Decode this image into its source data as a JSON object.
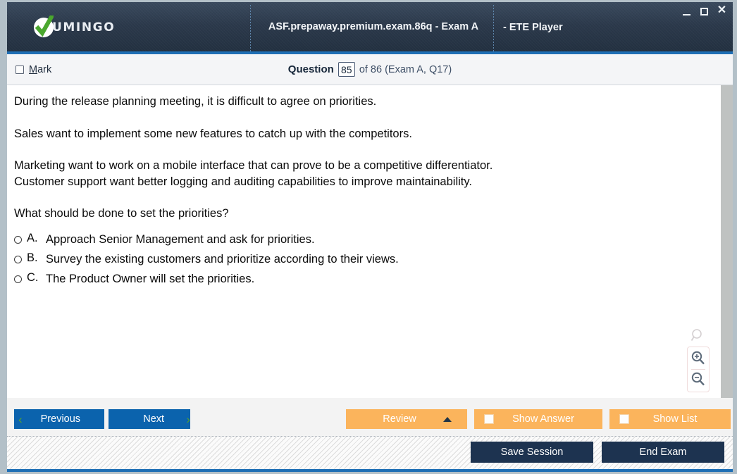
{
  "window": {
    "brand_name": "UMINGO",
    "brand_icon": "green-check-circle-icon",
    "title": "ASF.prepaway.premium.exam.86q - Exam A",
    "title_tail": "- ETE Player",
    "controls": {
      "minimize": "minimize-icon",
      "maximize": "maximize-icon",
      "close": "✕"
    },
    "accent_color": "#1f6fb5"
  },
  "status_bar": {
    "mark_label_prefix": "",
    "mark_label": "Mark",
    "mark_checked": false,
    "question_word": "Question",
    "question_number": "85",
    "question_total": "of 86 (Exam A, Q17)"
  },
  "question": {
    "paragraphs": [
      "During the release planning meeting, it is difficult to agree on priorities.",
      "Sales want to implement some new features to catch up with the competitors.",
      "Marketing want to work on a mobile interface that can prove to be a competitive differentiator.",
      "Customer support want better logging and auditing capabilities to improve maintainability.",
      "What should be done to set the priorities?"
    ],
    "answers": [
      {
        "letter": "A.",
        "text": "Approach Senior Management and ask for priorities.",
        "selected": false
      },
      {
        "letter": "B.",
        "text": "Survey the existing customers and prioritize according to their views.",
        "selected": false
      },
      {
        "letter": "C.",
        "text": "The Product Owner will set the priorities.",
        "selected": false
      }
    ]
  },
  "zoom_tools": {
    "reset": "magnifier-icon",
    "zoom_in": "magnifier-plus-icon",
    "zoom_out": "magnifier-minus-icon"
  },
  "toolbar": {
    "previous_label": "Previous",
    "next_label": "Next",
    "previous_chevron": "‹",
    "next_chevron": "›",
    "review_label": "Review",
    "show_answer_label": "Show Answer",
    "show_list_label": "Show List",
    "show_answer_checked": false,
    "show_list_checked": false,
    "nav_button_color": "#0b63ad",
    "chevron_color": "#52a032",
    "orange_color": "#fbb45c"
  },
  "footer": {
    "save_session_label": "Save Session",
    "end_exam_label": "End Exam",
    "dark_button_color": "#1d3350"
  }
}
